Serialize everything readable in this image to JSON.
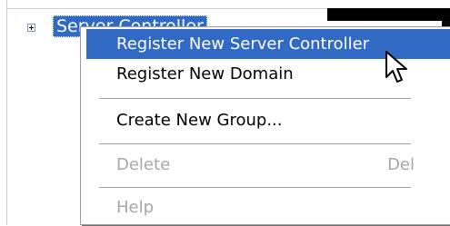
{
  "tree": {
    "node_label": "Server Controller",
    "expander_icon": "plus-box-icon"
  },
  "context_menu": {
    "items": [
      {
        "label": "Register New Server Controller",
        "state": "selected"
      },
      {
        "label": "Register New Domain",
        "state": "enabled"
      },
      {
        "label": "Create New Group...",
        "state": "enabled"
      },
      {
        "label": "Delete",
        "shortcut": "Del",
        "state": "disabled"
      },
      {
        "label": "Help",
        "state": "disabled"
      }
    ]
  },
  "cursor": {
    "icon": "arrow-pointer-icon"
  },
  "colors": {
    "selection": "#316ac5",
    "disabled_text": "#a7a6aa"
  }
}
